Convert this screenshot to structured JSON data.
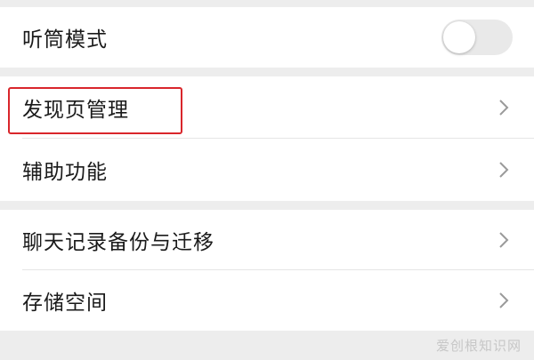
{
  "settings": {
    "group1": {
      "earpiece_mode": {
        "label": "听筒模式",
        "toggle_on": false
      }
    },
    "group2": {
      "discover_page": {
        "label": "发现页管理"
      },
      "accessibility": {
        "label": "辅助功能"
      }
    },
    "group3": {
      "chat_backup": {
        "label": "聊天记录备份与迁移"
      },
      "storage": {
        "label": "存储空间"
      }
    }
  },
  "watermark": {
    "text": "爱创根知识网"
  },
  "colors": {
    "background": "#ededed",
    "row": "#ffffff",
    "highlight": "#d9262b",
    "toggle_off": "#e9e9e9"
  },
  "icons": {
    "chevron": "chevron-right-icon"
  }
}
